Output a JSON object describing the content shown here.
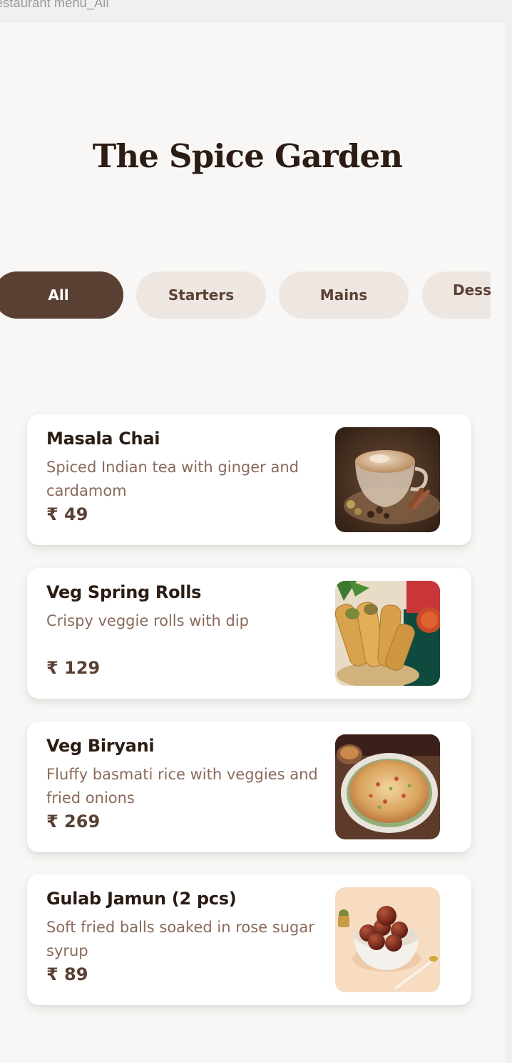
{
  "window": {
    "title": "estaurant menu_All"
  },
  "header": {
    "title": "The Spice Garden"
  },
  "tabs": [
    {
      "label": "All",
      "active": true
    },
    {
      "label": "Starters",
      "active": false
    },
    {
      "label": "Mains",
      "active": false
    },
    {
      "label": "Dess",
      "active": false
    }
  ],
  "currency": "₹",
  "menu": [
    {
      "name": "Masala Chai",
      "description": "Spiced Indian tea with ginger and cardamom",
      "price": "₹ 49",
      "image": "masala-chai-image"
    },
    {
      "name": "Veg Spring Rolls",
      "description": "Crispy veggie rolls with dip",
      "price": "₹ 129",
      "image": "spring-rolls-image"
    },
    {
      "name": "Veg Biryani",
      "description": "Fluffy basmati rice with veggies and fried onions",
      "price": "₹ 269",
      "image": "biryani-image"
    },
    {
      "name": "Gulab Jamun (2 pcs)",
      "description": "Soft fried balls soaked in rose sugar syrup",
      "price": "₹ 89",
      "image": "gulab-jamun-image"
    }
  ],
  "colors": {
    "accent": "#5a3f33",
    "tab_inactive": "#eee7e1",
    "title": "#2b1c14",
    "description": "#8a6a5b",
    "background": "#f8f7f5"
  }
}
